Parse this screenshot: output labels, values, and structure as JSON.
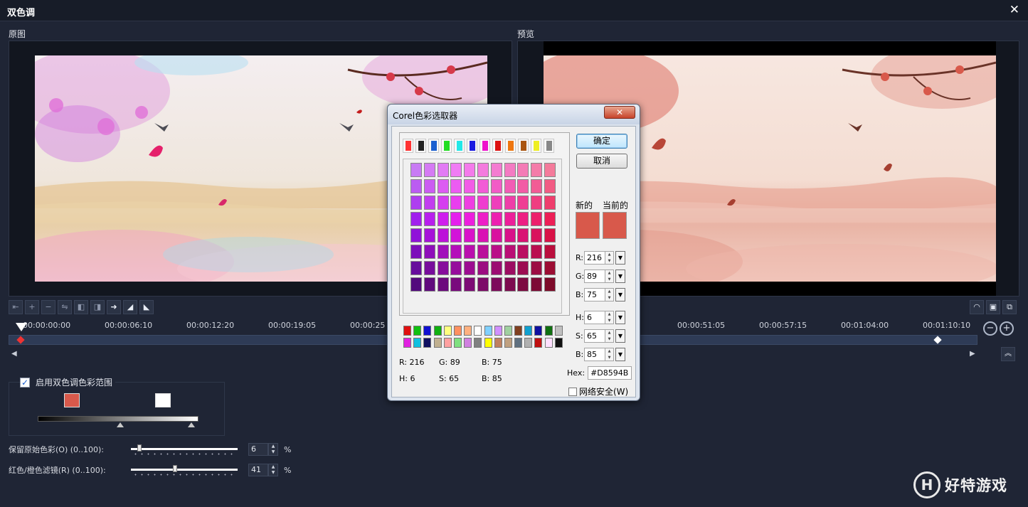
{
  "window": {
    "title": "双色调",
    "close_glyph": "✕"
  },
  "panes": {
    "original_label": "原图",
    "preview_label": "预览"
  },
  "toolbar": {
    "left_buttons": [
      "go-start",
      "add-keyframe",
      "remove-keyframe",
      "reverse-keyframes",
      "prev-keyframe",
      "next-keyframe",
      "move-right",
      "fade-in",
      "fade-out"
    ],
    "right_buttons": [
      "performance-icon",
      "preview-screen-icon",
      "zoom-fit-icon"
    ]
  },
  "timeline": {
    "ticks": [
      "00:00:00:00",
      "00:00:06:10",
      "00:00:12:20",
      "00:00:19:05",
      "00:00:25",
      "00:00:51:05",
      "00:00:57:15",
      "00:01:04:00",
      "00:01:10:10"
    ],
    "zoom_out": "−",
    "zoom_in": "+"
  },
  "range": {
    "enabled_label": "启用双色调色彩范围",
    "checked": true,
    "color_a": "#D8594B",
    "color_b": "#FFFFFF"
  },
  "params": [
    {
      "label": "保留原始色彩(O) (0..100):",
      "value": "6",
      "fraction": 0.06,
      "unit": "%"
    },
    {
      "label": "红色/橙色滤镜(R) (0..100):",
      "value": "41",
      "fraction": 0.41,
      "unit": "%"
    }
  ],
  "watermark": {
    "logo": "H",
    "text": "好特游戏"
  },
  "color_picker": {
    "title": "Corel色彩选取器",
    "close_glyph": "✕",
    "ok_label": "确定",
    "cancel_label": "取消",
    "new_label": "新的",
    "current_label": "当前的",
    "new_color": "#D8594B",
    "current_color": "#D8594B",
    "palette_tabs": [
      "#ff3333",
      "#222222",
      "#1a5fd0",
      "#22dd22",
      "#22e8e8",
      "#1a1ae0",
      "#ee11cc",
      "#dd1111",
      "#ee7711",
      "#aa5511",
      "#eeee22",
      "#888888"
    ],
    "readout": {
      "r": "R: 216",
      "g": "G: 89",
      "b": "B: 75",
      "h": "H: 6",
      "s": "S: 65",
      "bv": "B: 85"
    },
    "fields": {
      "r_label": "R:",
      "r": "216",
      "g_label": "G:",
      "g": "89",
      "b_label": "B:",
      "b": "75",
      "h_label": "H:",
      "h": "6",
      "s_label": "S:",
      "s": "65",
      "bv_label": "B:",
      "bv": "85"
    },
    "hex_label": "Hex:",
    "hex": "#D8594B",
    "websafe_label": "网络安全(W)",
    "mini_palette": [
      "#e01010",
      "#10c010",
      "#1010d0",
      "#10b010",
      "#ffff80",
      "#ff9060",
      "#ffb080",
      "#ffffff",
      "#80d0ff",
      "#d090ff",
      "#a0d0a0",
      "#804020",
      "#10a0d0",
      "#1010a0",
      "#107010",
      "#c0c0c0",
      "#e020e0",
      "#10c0e0",
      "#101060",
      "#c0b090",
      "#ffa0a0",
      "#80e080",
      "#d080e0",
      "#808080",
      "#ffff00",
      "#c08060",
      "#c0a080",
      "#607080",
      "#b0b0b0",
      "#c01010",
      "#ffe0ff",
      "#101010"
    ]
  }
}
